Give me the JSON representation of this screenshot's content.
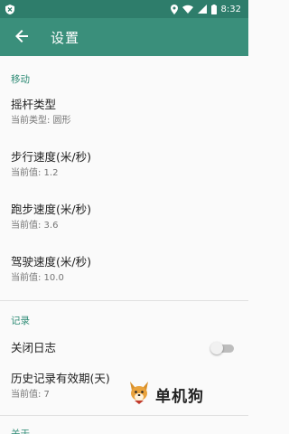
{
  "status_bar": {
    "time": "8:32",
    "icons": [
      "shield-icon",
      "location-icon",
      "wifi-icon",
      "signal-icon",
      "battery-icon"
    ]
  },
  "app_bar": {
    "title": "设置",
    "back_icon": "arrow-left-icon"
  },
  "sections": {
    "movement": {
      "header": "移动",
      "items": [
        {
          "title": "摇杆类型",
          "summary": "当前类型: 圆形"
        },
        {
          "title": "步行速度(米/秒)",
          "summary": "当前值: 1.2"
        },
        {
          "title": "跑步速度(米/秒)",
          "summary": "当前值: 3.6"
        },
        {
          "title": "驾驶速度(米/秒)",
          "summary": "当前值: 10.0"
        }
      ]
    },
    "record": {
      "header": "记录",
      "close_log": {
        "title": "关闭日志",
        "enabled": false
      },
      "history": {
        "title": "历史记录有效期(天)",
        "summary": "当前值: 7"
      }
    },
    "about": {
      "header": "关于"
    }
  },
  "watermark": {
    "text": "单机狗"
  },
  "colors": {
    "status_bar": "#2e7d6b",
    "app_bar": "#3a8f7b",
    "accent": "#2e8b75",
    "background": "#fafafa"
  }
}
